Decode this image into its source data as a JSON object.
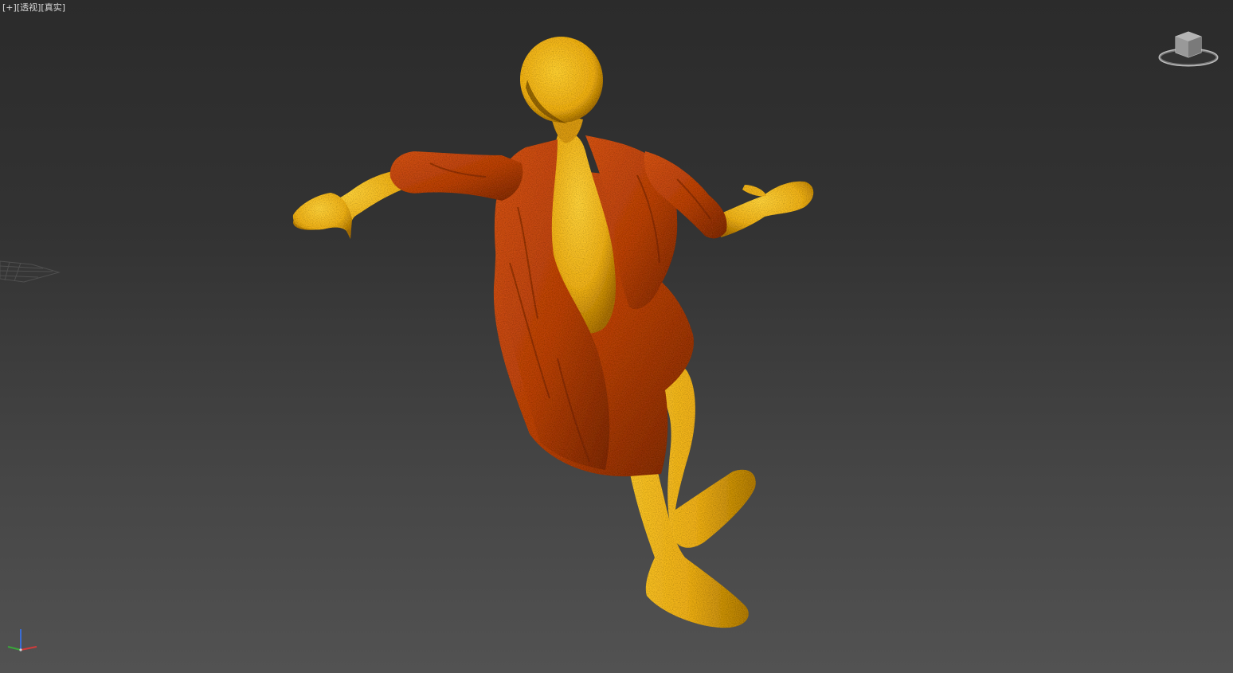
{
  "viewport": {
    "label_plus": "[+]",
    "label_view": "[透视]",
    "label_shading": "[真实]",
    "viewcube_icon": "viewcube-icon",
    "axis_icon": "axis-tripod-icon"
  },
  "scene": {
    "subject": "character-with-coat",
    "body_color": "#f0b21a",
    "coat_color": "#c2440e"
  }
}
